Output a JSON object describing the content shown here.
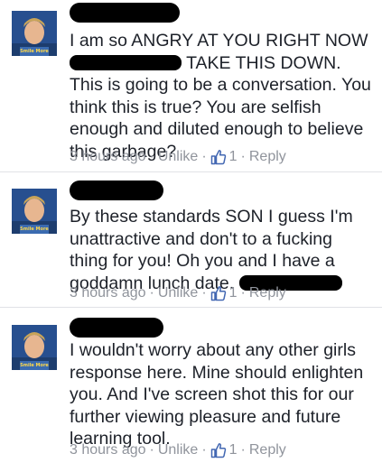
{
  "comments": [
    {
      "text_before": "I am so ANGRY AT YOU RIGHT NOW ",
      "text_after": " TAKE THIS DOWN.  This is going to be a conversation. You think this is true? You are selfish enough and diluted enough to believe this garbage?",
      "timestamp": "3 hours ago",
      "action": "Unlike",
      "like_count": "1",
      "reply": "Reply"
    },
    {
      "text_before": "By these standards SON I guess I'm unattractive and don't to a fucking thing for you! Oh you and I have a goddamn lunch date. ",
      "timestamp": "3 hours ago",
      "action": "Unlike",
      "like_count": "1",
      "reply": "Reply"
    },
    {
      "text_before": "I wouldn't worry about any other girls response here. Mine should enlighten you. And I've screen shot this for our further viewing pleasure and future learning tool.",
      "timestamp": "3 hours ago",
      "action": "Unlike",
      "like_count": "1",
      "reply": "Reply"
    }
  ],
  "separator": "·",
  "icons": {
    "like": "thumbs-up-icon"
  },
  "colors": {
    "text": "#1d2129",
    "meta": "#90949c",
    "like_blue": "#4267b2",
    "divider": "#e1e2e6"
  }
}
